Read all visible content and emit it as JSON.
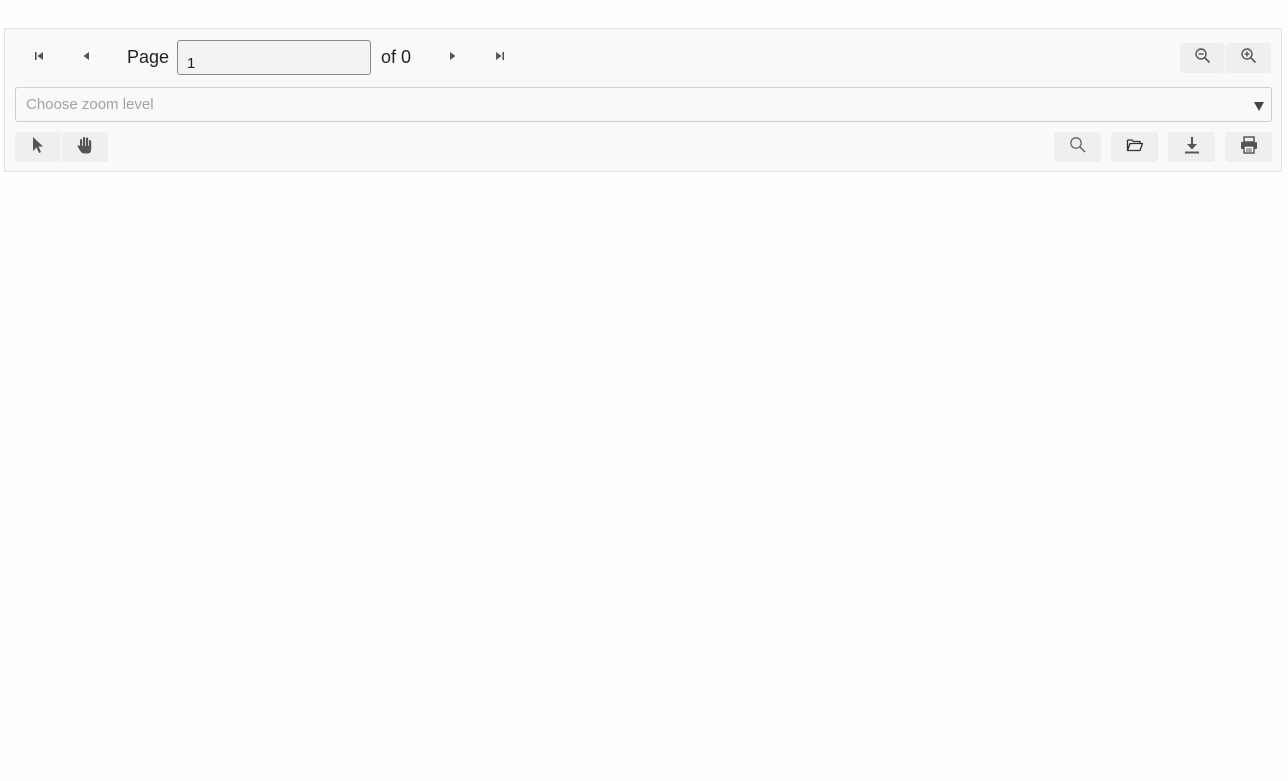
{
  "pager": {
    "page_label": "Page",
    "page_value": "1",
    "of_label": "of 0"
  },
  "zoom": {
    "placeholder": "Choose zoom level"
  },
  "icons": {
    "first": "first-page-icon",
    "prev": "previous-page-icon",
    "next": "next-page-icon",
    "last": "last-page-icon",
    "zoom_out": "zoom-out-icon",
    "zoom_in": "zoom-in-icon",
    "select": "pointer-cursor-icon",
    "hand": "hand-pan-icon",
    "search": "search-icon",
    "open": "open-folder-icon",
    "download": "download-icon",
    "print": "print-icon"
  },
  "colors": {
    "toolbar_bg": "#f9f9f9",
    "button_bg": "#efefef",
    "icon": "#555555"
  }
}
